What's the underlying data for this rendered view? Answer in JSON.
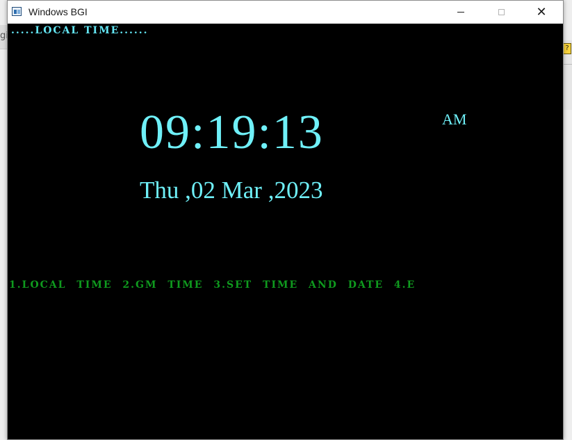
{
  "background_app": {
    "left_fragment": "gi",
    "right_icon": "?"
  },
  "window": {
    "title": "Windows BGI",
    "icon": "app-window-icon",
    "controls": {
      "minimize": "minimize-icon",
      "maximize": "maximize-icon",
      "close_glyph": "✕"
    }
  },
  "screen": {
    "mode_header": ".....LOCAL TIME......",
    "time": "09:19:13",
    "meridiem": "AM",
    "date": "Thu ,02 Mar ,2023",
    "menu": "1.LOCAL TIME 2.GM TIME 3.SET TIME AND DATE 4.E"
  },
  "colors": {
    "canvas_background": "#000000",
    "header_text": "#64e7f5",
    "clock_text": "#6ff0f8",
    "menu_text": "#0f9a1e",
    "titlebar": "#ffffff"
  }
}
